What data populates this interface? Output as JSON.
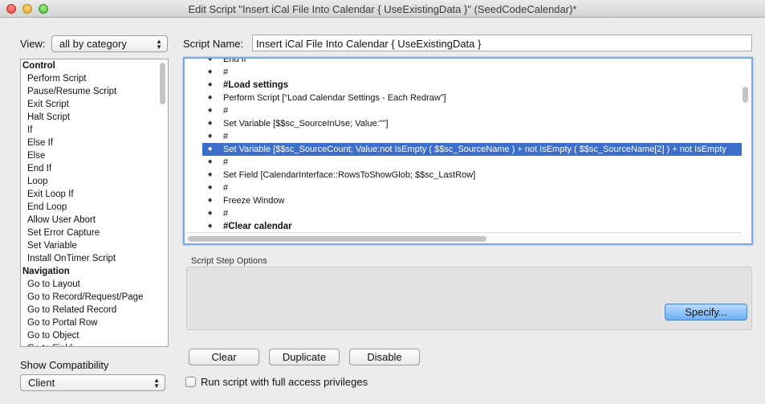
{
  "window": {
    "title": "Edit Script \"Insert iCal File Into Calendar { UseExistingData }\" (SeedCodeCalendar)*"
  },
  "left_panel": {
    "view_label": "View:",
    "view_value": "all by category",
    "steps": [
      {
        "label": "Control",
        "category": true
      },
      {
        "label": "Perform Script",
        "category": false
      },
      {
        "label": "Pause/Resume Script",
        "category": false
      },
      {
        "label": "Exit Script",
        "category": false
      },
      {
        "label": "Halt Script",
        "category": false
      },
      {
        "label": "If",
        "category": false
      },
      {
        "label": "Else If",
        "category": false
      },
      {
        "label": "Else",
        "category": false
      },
      {
        "label": "End If",
        "category": false
      },
      {
        "label": "Loop",
        "category": false
      },
      {
        "label": "Exit Loop If",
        "category": false
      },
      {
        "label": "End Loop",
        "category": false
      },
      {
        "label": "Allow User Abort",
        "category": false
      },
      {
        "label": "Set Error Capture",
        "category": false
      },
      {
        "label": "Set Variable",
        "category": false
      },
      {
        "label": "Install OnTimer Script",
        "category": false
      },
      {
        "label": "Navigation",
        "category": true
      },
      {
        "label": "Go to Layout",
        "category": false
      },
      {
        "label": "Go to Record/Request/Page",
        "category": false
      },
      {
        "label": "Go to Related Record",
        "category": false
      },
      {
        "label": "Go to Portal Row",
        "category": false
      },
      {
        "label": "Go to Object",
        "category": false
      },
      {
        "label": "Go to Field",
        "category": false
      }
    ],
    "show_compat_label": "Show Compatibility",
    "compat_value": "Client"
  },
  "script_name": {
    "label": "Script Name:",
    "value": "Insert iCal File Into Calendar { UseExistingData }"
  },
  "script_lines": [
    {
      "text": "End If",
      "bold": false,
      "selected": false
    },
    {
      "text": "#",
      "bold": false,
      "selected": false
    },
    {
      "text": "#Load settings",
      "bold": true,
      "selected": false
    },
    {
      "text": "Perform Script [“Load Calendar Settings - Each Redraw”]",
      "bold": false,
      "selected": false
    },
    {
      "text": "#",
      "bold": false,
      "selected": false
    },
    {
      "text": "Set Variable [$$sc_SourceInUse; Value:\"\"]",
      "bold": false,
      "selected": false
    },
    {
      "text": "#",
      "bold": false,
      "selected": false
    },
    {
      "text": "Set Variable [$$sc_SourceCount; Value:not IsEmpty ( $$sc_SourceName ) + not IsEmpty ( $$sc_SourceName[2]  ) + not IsEmpty",
      "bold": false,
      "selected": true
    },
    {
      "text": "#",
      "bold": false,
      "selected": false
    },
    {
      "text": "Set Field [CalendarInterface::RowsToShowGlob; $$sc_LastRow]",
      "bold": false,
      "selected": false
    },
    {
      "text": "#",
      "bold": false,
      "selected": false
    },
    {
      "text": "Freeze Window",
      "bold": false,
      "selected": false
    },
    {
      "text": "#",
      "bold": false,
      "selected": false
    },
    {
      "text": "#Clear calendar",
      "bold": true,
      "selected": false
    }
  ],
  "options": {
    "label": "Script Step Options",
    "specify_label": "Specify..."
  },
  "actions": {
    "clear": "Clear",
    "duplicate": "Duplicate",
    "disable": "Disable"
  },
  "privileges_label": "Run script with full access privileges"
}
